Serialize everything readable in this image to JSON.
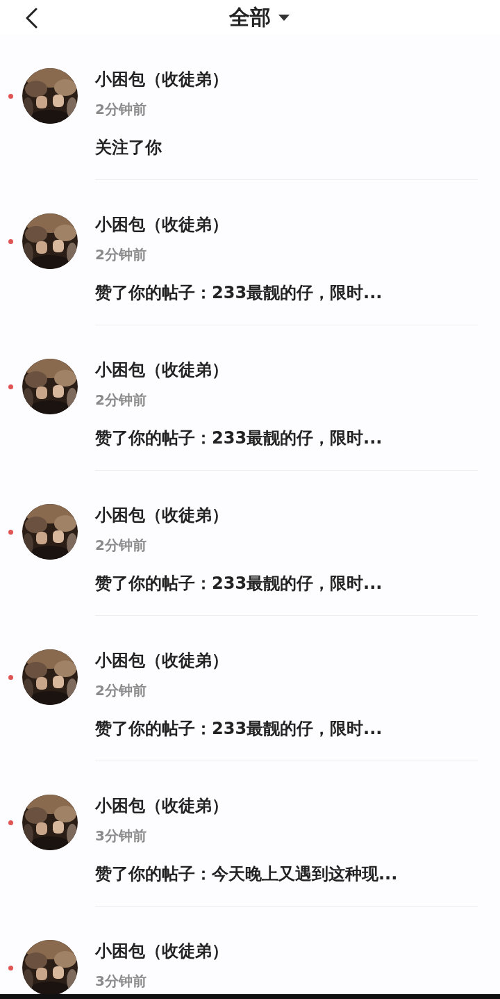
{
  "header": {
    "title": "全部",
    "has_dropdown": true
  },
  "notifications": [
    {
      "name": "小困包（收徒弟）",
      "time": "2分钟前",
      "message": "关注了你",
      "unread": true
    },
    {
      "name": "小困包（收徒弟）",
      "time": "2分钟前",
      "message": "赞了你的帖子：233最靓的仔，限时...",
      "unread": true
    },
    {
      "name": "小困包（收徒弟）",
      "time": "2分钟前",
      "message": "赞了你的帖子：233最靓的仔，限时...",
      "unread": true
    },
    {
      "name": "小困包（收徒弟）",
      "time": "2分钟前",
      "message": "赞了你的帖子：233最靓的仔，限时...",
      "unread": true
    },
    {
      "name": "小困包（收徒弟）",
      "time": "2分钟前",
      "message": "赞了你的帖子：233最靓的仔，限时...",
      "unread": true
    },
    {
      "name": "小困包（收徒弟）",
      "time": "3分钟前",
      "message": "赞了你的帖子：今天晚上又遇到这种现...",
      "unread": true
    },
    {
      "name": "小困包（收徒弟）",
      "time": "3分钟前",
      "unread": true
    }
  ]
}
